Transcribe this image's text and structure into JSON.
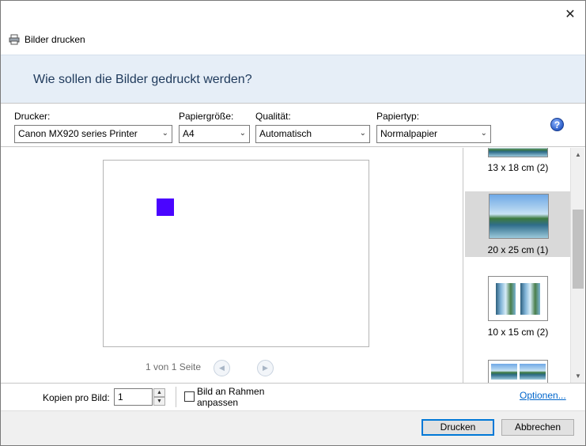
{
  "window": {
    "title": "Bilder drucken",
    "close_glyph": "✕"
  },
  "banner": {
    "heading": "Wie sollen die Bilder gedruckt werden?"
  },
  "controls": {
    "printer": {
      "label": "Drucker:",
      "value": "Canon MX920 series Printer"
    },
    "paper_size": {
      "label": "Papiergröße:",
      "value": "A4"
    },
    "quality": {
      "label": "Qualität:",
      "value": "Automatisch"
    },
    "paper_type": {
      "label": "Papiertyp:",
      "value": "Normalpapier"
    },
    "help_glyph": "?"
  },
  "preview": {
    "page_indicator": "1 von 1 Seite",
    "image_color": "#4a05ff"
  },
  "layouts": [
    {
      "caption": "13 x 18 cm (2)",
      "selected": false
    },
    {
      "caption": "20 x 25 cm (1)",
      "selected": true
    },
    {
      "caption": "10 x 15 cm (2)",
      "selected": false
    },
    {
      "caption": "",
      "selected": false
    }
  ],
  "bottom": {
    "copies_label": "Kopien pro Bild:",
    "copies_value": "1",
    "fit_label": "Bild an Rahmen anpassen",
    "fit_checked": false,
    "options_link": "Optionen..."
  },
  "footer": {
    "print_button": "Drucken",
    "cancel_button": "Abbrechen"
  }
}
